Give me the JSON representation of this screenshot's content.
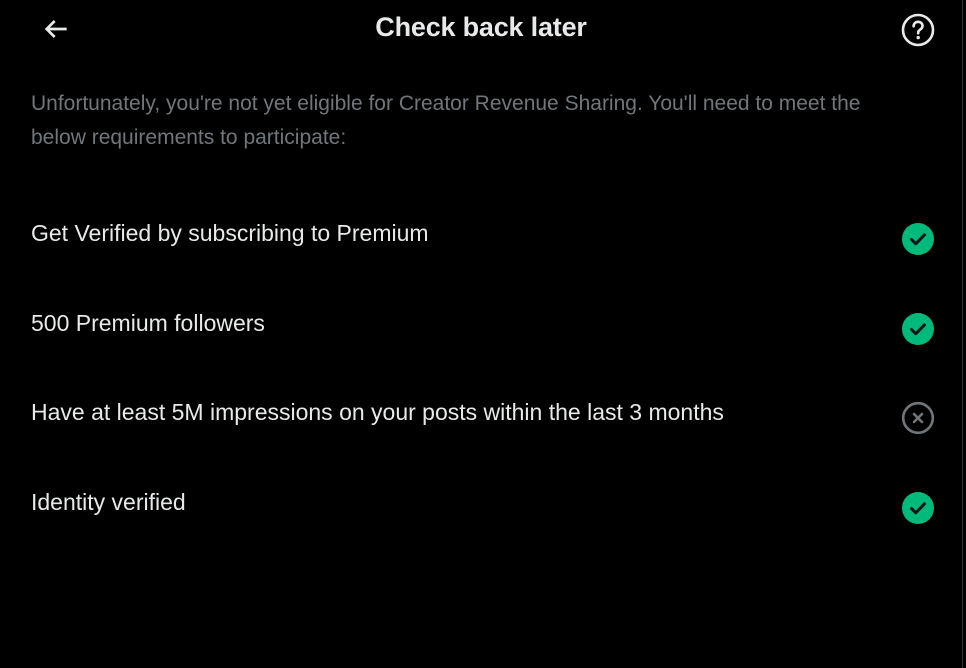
{
  "header": {
    "title": "Check back later",
    "back_icon": "arrow-left-icon",
    "help_icon": "question-circle-icon"
  },
  "intro_text": "Unfortunately, you're not yet eligible for Creator Revenue Sharing. You'll need to meet the below requirements to participate:",
  "requirements": [
    {
      "label": "Get Verified by subscribing to Premium",
      "status": "met",
      "icon": "check-circle-icon"
    },
    {
      "label": "500 Premium followers",
      "status": "met",
      "icon": "check-circle-icon"
    },
    {
      "label": "Have at least 5M impressions on your posts within the last 3 months",
      "status": "not-met",
      "icon": "x-circle-icon"
    },
    {
      "label": "Identity verified",
      "status": "met",
      "icon": "check-circle-icon"
    }
  ],
  "colors": {
    "background": "#000000",
    "text_primary": "#e7e9ea",
    "text_secondary": "#71767b",
    "success": "#00ba7c",
    "neutral_icon": "#71767b"
  }
}
